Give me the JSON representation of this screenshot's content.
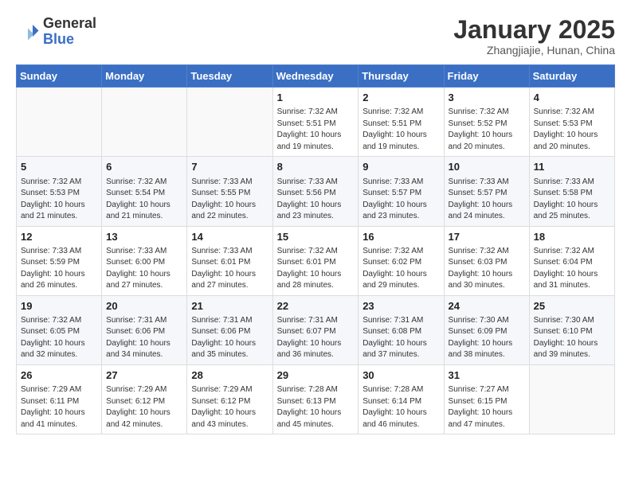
{
  "header": {
    "logo_general": "General",
    "logo_blue": "Blue",
    "month_title": "January 2025",
    "location": "Zhangjiajie, Hunan, China"
  },
  "weekdays": [
    "Sunday",
    "Monday",
    "Tuesday",
    "Wednesday",
    "Thursday",
    "Friday",
    "Saturday"
  ],
  "weeks": [
    [
      {
        "day": "",
        "info": ""
      },
      {
        "day": "",
        "info": ""
      },
      {
        "day": "",
        "info": ""
      },
      {
        "day": "1",
        "info": "Sunrise: 7:32 AM\nSunset: 5:51 PM\nDaylight: 10 hours and 19 minutes."
      },
      {
        "day": "2",
        "info": "Sunrise: 7:32 AM\nSunset: 5:51 PM\nDaylight: 10 hours and 19 minutes."
      },
      {
        "day": "3",
        "info": "Sunrise: 7:32 AM\nSunset: 5:52 PM\nDaylight: 10 hours and 20 minutes."
      },
      {
        "day": "4",
        "info": "Sunrise: 7:32 AM\nSunset: 5:53 PM\nDaylight: 10 hours and 20 minutes."
      }
    ],
    [
      {
        "day": "5",
        "info": "Sunrise: 7:32 AM\nSunset: 5:53 PM\nDaylight: 10 hours and 21 minutes."
      },
      {
        "day": "6",
        "info": "Sunrise: 7:32 AM\nSunset: 5:54 PM\nDaylight: 10 hours and 21 minutes."
      },
      {
        "day": "7",
        "info": "Sunrise: 7:33 AM\nSunset: 5:55 PM\nDaylight: 10 hours and 22 minutes."
      },
      {
        "day": "8",
        "info": "Sunrise: 7:33 AM\nSunset: 5:56 PM\nDaylight: 10 hours and 23 minutes."
      },
      {
        "day": "9",
        "info": "Sunrise: 7:33 AM\nSunset: 5:57 PM\nDaylight: 10 hours and 23 minutes."
      },
      {
        "day": "10",
        "info": "Sunrise: 7:33 AM\nSunset: 5:57 PM\nDaylight: 10 hours and 24 minutes."
      },
      {
        "day": "11",
        "info": "Sunrise: 7:33 AM\nSunset: 5:58 PM\nDaylight: 10 hours and 25 minutes."
      }
    ],
    [
      {
        "day": "12",
        "info": "Sunrise: 7:33 AM\nSunset: 5:59 PM\nDaylight: 10 hours and 26 minutes."
      },
      {
        "day": "13",
        "info": "Sunrise: 7:33 AM\nSunset: 6:00 PM\nDaylight: 10 hours and 27 minutes."
      },
      {
        "day": "14",
        "info": "Sunrise: 7:33 AM\nSunset: 6:01 PM\nDaylight: 10 hours and 27 minutes."
      },
      {
        "day": "15",
        "info": "Sunrise: 7:32 AM\nSunset: 6:01 PM\nDaylight: 10 hours and 28 minutes."
      },
      {
        "day": "16",
        "info": "Sunrise: 7:32 AM\nSunset: 6:02 PM\nDaylight: 10 hours and 29 minutes."
      },
      {
        "day": "17",
        "info": "Sunrise: 7:32 AM\nSunset: 6:03 PM\nDaylight: 10 hours and 30 minutes."
      },
      {
        "day": "18",
        "info": "Sunrise: 7:32 AM\nSunset: 6:04 PM\nDaylight: 10 hours and 31 minutes."
      }
    ],
    [
      {
        "day": "19",
        "info": "Sunrise: 7:32 AM\nSunset: 6:05 PM\nDaylight: 10 hours and 32 minutes."
      },
      {
        "day": "20",
        "info": "Sunrise: 7:31 AM\nSunset: 6:06 PM\nDaylight: 10 hours and 34 minutes."
      },
      {
        "day": "21",
        "info": "Sunrise: 7:31 AM\nSunset: 6:06 PM\nDaylight: 10 hours and 35 minutes."
      },
      {
        "day": "22",
        "info": "Sunrise: 7:31 AM\nSunset: 6:07 PM\nDaylight: 10 hours and 36 minutes."
      },
      {
        "day": "23",
        "info": "Sunrise: 7:31 AM\nSunset: 6:08 PM\nDaylight: 10 hours and 37 minutes."
      },
      {
        "day": "24",
        "info": "Sunrise: 7:30 AM\nSunset: 6:09 PM\nDaylight: 10 hours and 38 minutes."
      },
      {
        "day": "25",
        "info": "Sunrise: 7:30 AM\nSunset: 6:10 PM\nDaylight: 10 hours and 39 minutes."
      }
    ],
    [
      {
        "day": "26",
        "info": "Sunrise: 7:29 AM\nSunset: 6:11 PM\nDaylight: 10 hours and 41 minutes."
      },
      {
        "day": "27",
        "info": "Sunrise: 7:29 AM\nSunset: 6:12 PM\nDaylight: 10 hours and 42 minutes."
      },
      {
        "day": "28",
        "info": "Sunrise: 7:29 AM\nSunset: 6:12 PM\nDaylight: 10 hours and 43 minutes."
      },
      {
        "day": "29",
        "info": "Sunrise: 7:28 AM\nSunset: 6:13 PM\nDaylight: 10 hours and 45 minutes."
      },
      {
        "day": "30",
        "info": "Sunrise: 7:28 AM\nSunset: 6:14 PM\nDaylight: 10 hours and 46 minutes."
      },
      {
        "day": "31",
        "info": "Sunrise: 7:27 AM\nSunset: 6:15 PM\nDaylight: 10 hours and 47 minutes."
      },
      {
        "day": "",
        "info": ""
      }
    ]
  ]
}
